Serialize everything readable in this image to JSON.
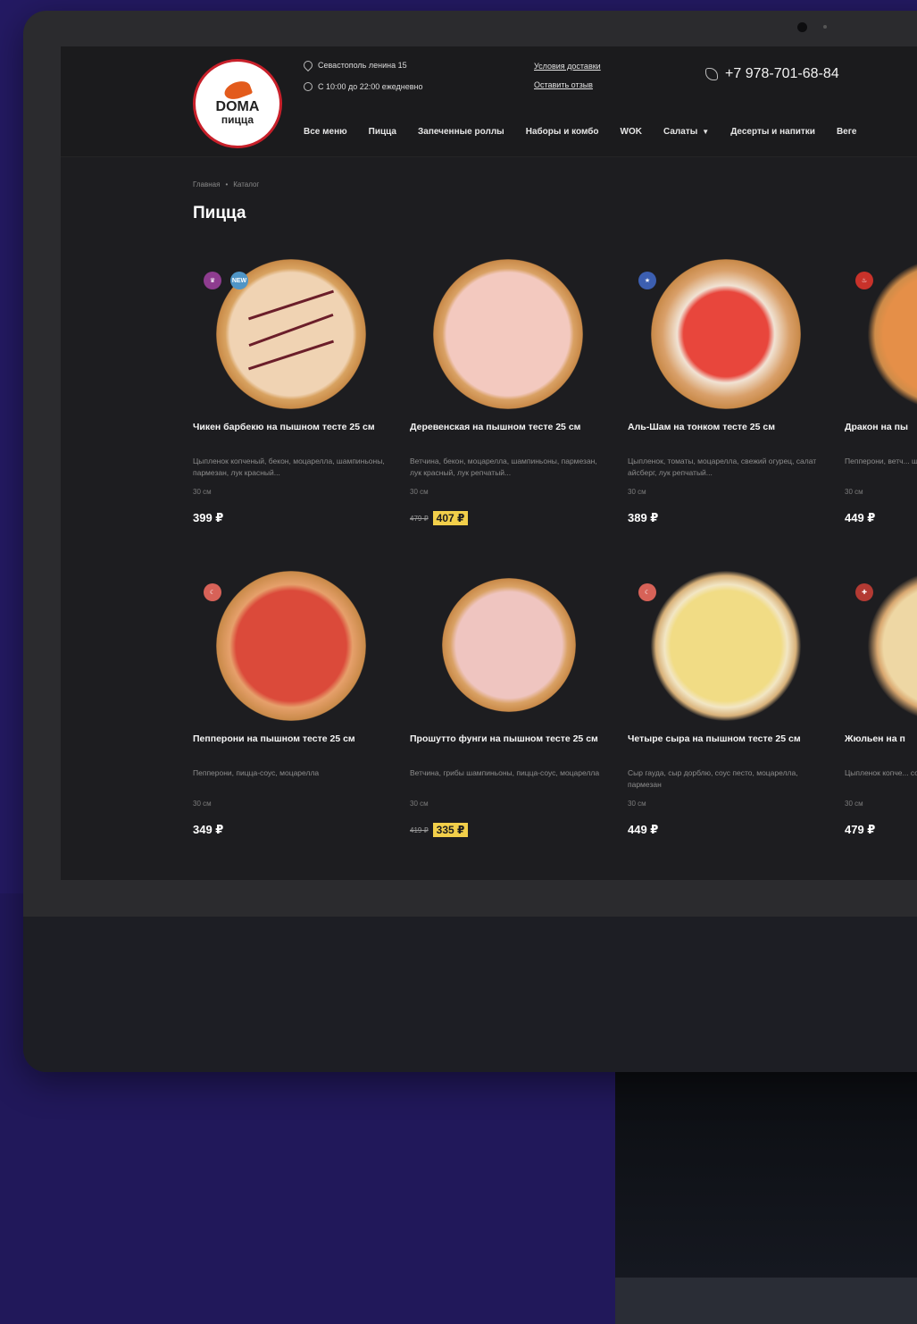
{
  "header": {
    "address": "Севастополь ленина 15",
    "hours": "С 10:00 до 22:00 ежедневно",
    "link_delivery": "Условия доставки",
    "link_review": "Оставить отзыв",
    "phone": "+7 978-701-68-84",
    "logo_line1": "DOMA",
    "logo_line2": "пицца"
  },
  "nav": {
    "items": [
      "Все меню",
      "Пицца",
      "Запеченные роллы",
      "Наборы и комбо",
      "WOK",
      "Салаты",
      "Десерты и напитки",
      "Веге"
    ]
  },
  "breadcrumb": {
    "home": "Главная",
    "sep": "•",
    "catalog": "Каталог"
  },
  "page_title": "Пицца",
  "products": [
    {
      "name": "Чикен барбекю на пышном тесте 25 см",
      "description": "Цыпленок копченый, бекон, моцарелла, шампиньоны, пармезан, лук красный...",
      "size": "30 см",
      "price": "399 ₽",
      "badges": [
        "hat-icon",
        "new-badge"
      ],
      "badge_text": "NEW"
    },
    {
      "name": "Деревенская на пышном тесте 25 см",
      "description": "Ветчина, бекон, моцарелла, шампиньоны, пармезан, лук красный, лук репчатый...",
      "size": "30 см",
      "old_price": "479 ₽",
      "price": "407 ₽"
    },
    {
      "name": "Аль-Шам на тонком тесте 25 см",
      "description": "Цыпленок, томаты, моцарелла, свежий огурец, салат айсберг, лук репчатый...",
      "size": "30 см",
      "price": "389 ₽",
      "badges": [
        "like-icon"
      ]
    },
    {
      "name": "Дракон на пы",
      "description": "Пепперони, ветч... шампиньоны, п",
      "size": "30 см",
      "price": "449 ₽",
      "badges": [
        "chili-icon"
      ]
    },
    {
      "name": "Пепперони на пышном тесте 25 см",
      "description": "Пепперони, пицца-соус, моцарелла",
      "size": "30 см",
      "price": "349 ₽",
      "badges": [
        "moon-icon"
      ]
    },
    {
      "name": "Прошутто фунги на пышном тесте 25 см",
      "description": "Ветчина, грибы шампиньоны, пицца-соус, моцарелла",
      "size": "30 см",
      "old_price": "419 ₽",
      "price": "335 ₽"
    },
    {
      "name": "Четыре сыра на пышном тесте 25 см",
      "description": "Сыр гауда, сыр дорблю, соус песто, моцарелла, пармезан",
      "size": "30 см",
      "price": "449 ₽",
      "badges": [
        "moon-icon"
      ]
    },
    {
      "name": "Жюльен на п",
      "description": "Цыпленок копче... соус грибной, м",
      "size": "30 см",
      "price": "479 ₽",
      "badges": [
        "gift-icon"
      ]
    }
  ],
  "colors": {
    "page_bg": "#241a63",
    "screen_bg": "#1c1c1e",
    "accent_sale": "#f2cf4a",
    "logo_ring": "#c8202a"
  }
}
